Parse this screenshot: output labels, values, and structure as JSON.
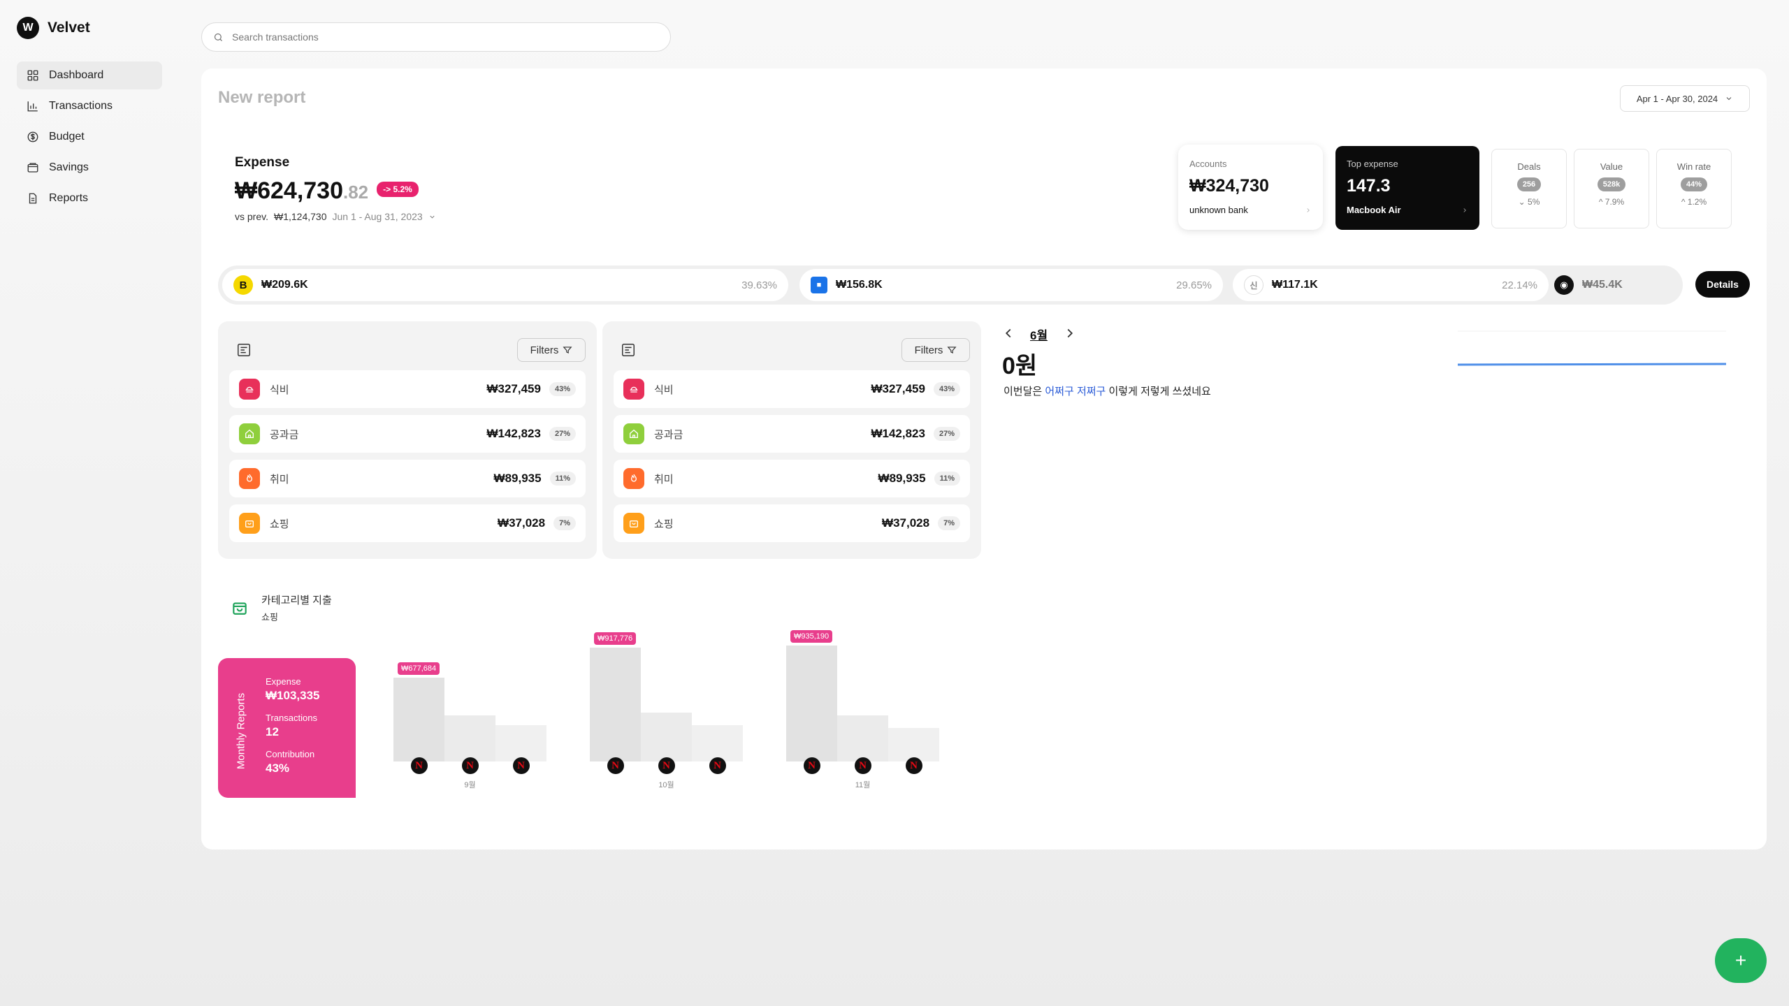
{
  "app": {
    "name": "Velvet",
    "logo_glyph": "W"
  },
  "sidebar": {
    "items": [
      {
        "label": "Dashboard",
        "icon": "grid-icon",
        "active": true
      },
      {
        "label": "Transactions",
        "icon": "bar-chart-icon"
      },
      {
        "label": "Budget",
        "icon": "dollar-circle-icon"
      },
      {
        "label": "Savings",
        "icon": "wallet-icon"
      },
      {
        "label": "Reports",
        "icon": "document-icon"
      }
    ]
  },
  "search": {
    "placeholder": "Search transactions",
    "value": ""
  },
  "report": {
    "title": "New report",
    "date_range": "Apr 1 - Apr 30, 2024"
  },
  "expense": {
    "label": "Expense",
    "amount_main": "₩624,730",
    "amount_cents": ".82",
    "change_badge": "-> 5.2%",
    "vs_label": "vs prev.",
    "prev_amount": "₩1,124,730",
    "prev_range": "Jun 1 - Aug 31, 2023"
  },
  "cards": {
    "accounts": {
      "label": "Accounts",
      "value": "₩324,730",
      "footer": "unknown bank"
    },
    "top_expense": {
      "label": "Top expense",
      "value": "147.3",
      "footer": "Macbook Air"
    },
    "deals": {
      "label": "Deals",
      "value": "256",
      "delta": "5%",
      "direction": "down"
    },
    "value": {
      "label": "Value",
      "value": "528k",
      "delta": "7.9%",
      "direction": "up"
    },
    "win_rate": {
      "label": "Win rate",
      "value": "44%",
      "delta": "1.2%",
      "direction": "up"
    }
  },
  "contribution": {
    "segments": [
      {
        "icon": "B",
        "amount": "₩209.6K",
        "percent": "39.63%",
        "color": "#f5d800"
      },
      {
        "icon": "bank-logo",
        "amount": "₩156.8K",
        "percent": "29.65%",
        "color": "#1a73e8"
      },
      {
        "icon": "신",
        "amount": "₩117.1K",
        "percent": "22.14%",
        "color": "#ffffff"
      },
      {
        "icon": "piggy-icon",
        "amount": "₩45.4K",
        "percent": "",
        "color": "#111111"
      }
    ],
    "details_label": "Details"
  },
  "category_lists": [
    {
      "filters_label": "Filters",
      "rows": [
        {
          "name": "식비",
          "amount": "₩327,459",
          "percent": "43%",
          "color": "#e8305a",
          "icon": "food-icon"
        },
        {
          "name": "공과금",
          "amount": "₩142,823",
          "percent": "27%",
          "color": "#8fcf3c",
          "icon": "home-icon"
        },
        {
          "name": "취미",
          "amount": "₩89,935",
          "percent": "11%",
          "color": "#ff6b2c",
          "icon": "flame-icon"
        },
        {
          "name": "쇼핑",
          "amount": "₩37,028",
          "percent": "7%",
          "color": "#ff9f1a",
          "icon": "bag-icon"
        }
      ]
    },
    {
      "filters_label": "Filters",
      "rows": [
        {
          "name": "식비",
          "amount": "₩327,459",
          "percent": "43%",
          "color": "#e8305a",
          "icon": "food-icon"
        },
        {
          "name": "공과금",
          "amount": "₩142,823",
          "percent": "27%",
          "color": "#8fcf3c",
          "icon": "home-icon"
        },
        {
          "name": "취미",
          "amount": "₩89,935",
          "percent": "11%",
          "color": "#ff6b2c",
          "icon": "flame-icon"
        },
        {
          "name": "쇼핑",
          "amount": "₩37,028",
          "percent": "7%",
          "color": "#ff9f1a",
          "icon": "bag-icon"
        }
      ]
    }
  ],
  "month_summary": {
    "month": "6월",
    "total": "0원",
    "sentence_pre": "이번달은 ",
    "sentence_hl": "어쩌구 저쩌구",
    "sentence_post": " 이렇게 저렇게 쓰셨네요"
  },
  "category_spend": {
    "title": "카테고리별 지출",
    "subtitle": "쇼핑",
    "monthly_reports": {
      "vertical_label": "Monthly Reports",
      "expense_label": "Expense",
      "expense_value": "₩103,335",
      "transactions_label": "Transactions",
      "transactions_value": "12",
      "contribution_label": "Contribution",
      "contribution_value": "43%"
    }
  },
  "chart_data": {
    "type": "bar",
    "categories": [
      "9월",
      "10월",
      "11월"
    ],
    "series": [
      {
        "values": [
          677684,
          917776,
          935190
        ]
      },
      {
        "values": [
          null,
          null,
          null
        ]
      },
      {
        "values": [
          null,
          null,
          null
        ]
      }
    ],
    "bar_labels": [
      "₩677,684",
      "₩917,776",
      "₩935,190"
    ],
    "bar_icon": "netflix-icon",
    "accent": "#e83e8c"
  },
  "fab": {
    "label": "+"
  }
}
